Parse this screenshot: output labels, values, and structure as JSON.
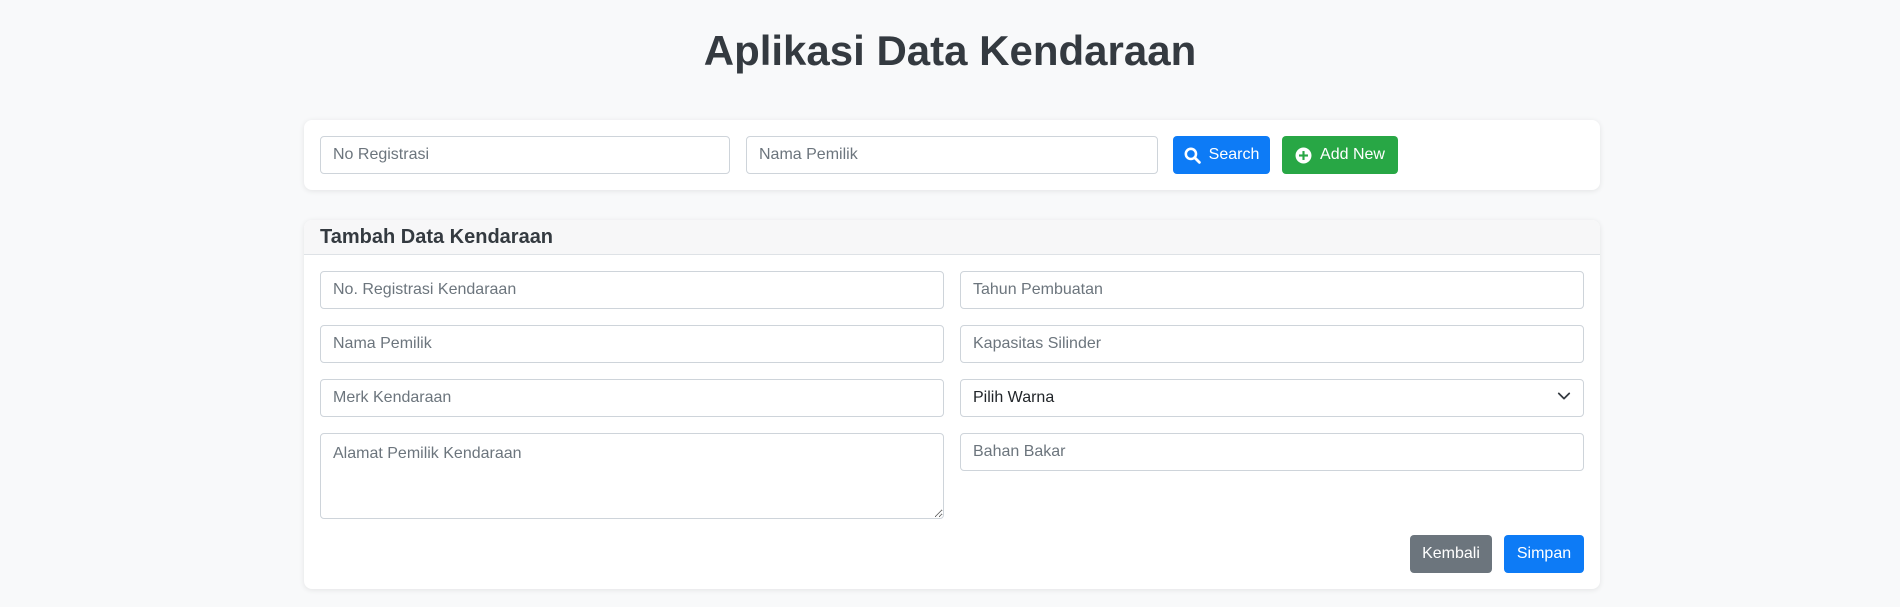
{
  "header": {
    "title": "Aplikasi Data Kendaraan"
  },
  "search": {
    "registration_placeholder": "No Registrasi",
    "owner_placeholder": "Nama Pemilik",
    "search_label": "Search",
    "add_new_label": "Add New"
  },
  "form": {
    "title": "Tambah Data Kendaraan",
    "registration_placeholder": "No. Registrasi Kendaraan",
    "owner_name_placeholder": "Nama Pemilik",
    "brand_placeholder": "Merk Kendaraan",
    "address_placeholder": "Alamat Pemilik Kendaraan",
    "year_placeholder": "Tahun Pembuatan",
    "cylinder_placeholder": "Kapasitas Silinder",
    "color_select_value": "Pilih Warna",
    "fuel_placeholder": "Bahan Bakar",
    "back_label": "Kembali",
    "save_label": "Simpan"
  },
  "colors": {
    "primary": "#0d7bf6",
    "success": "#28a745",
    "secondary": "#6c757d"
  },
  "icons": {
    "search": "search-icon",
    "add": "plus-circle-icon",
    "dropdown": "chevron-down-icon"
  }
}
